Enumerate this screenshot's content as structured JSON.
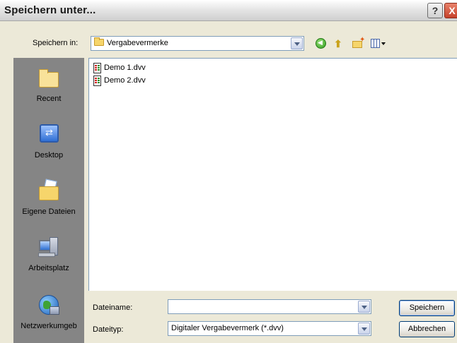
{
  "window": {
    "title": "Speichern unter..."
  },
  "titlebar": {
    "help_label": "?",
    "close_label": "X"
  },
  "toolbar": {
    "lookin_label": "Speichern in:",
    "lookin_value": "Vergabevermerke"
  },
  "places": {
    "items": [
      {
        "label": "Recent",
        "icon": "recent-folder-icon"
      },
      {
        "label": "Desktop",
        "icon": "desktop-icon"
      },
      {
        "label": "Eigene Dateien",
        "icon": "my-documents-icon"
      },
      {
        "label": "Arbeitsplatz",
        "icon": "my-computer-icon"
      },
      {
        "label": "Netzwerkumgeb",
        "icon": "network-icon"
      }
    ]
  },
  "files": [
    {
      "name": "Demo 1.dvv"
    },
    {
      "name": "Demo 2.dvv"
    }
  ],
  "form": {
    "filename_label": "Dateiname:",
    "filename_value": "",
    "filetype_label": "Dateityp:",
    "filetype_value": "Digitaler Vergabevermerk (*.dvv)"
  },
  "buttons": {
    "save": "Speichern",
    "cancel": "Abbrechen"
  }
}
